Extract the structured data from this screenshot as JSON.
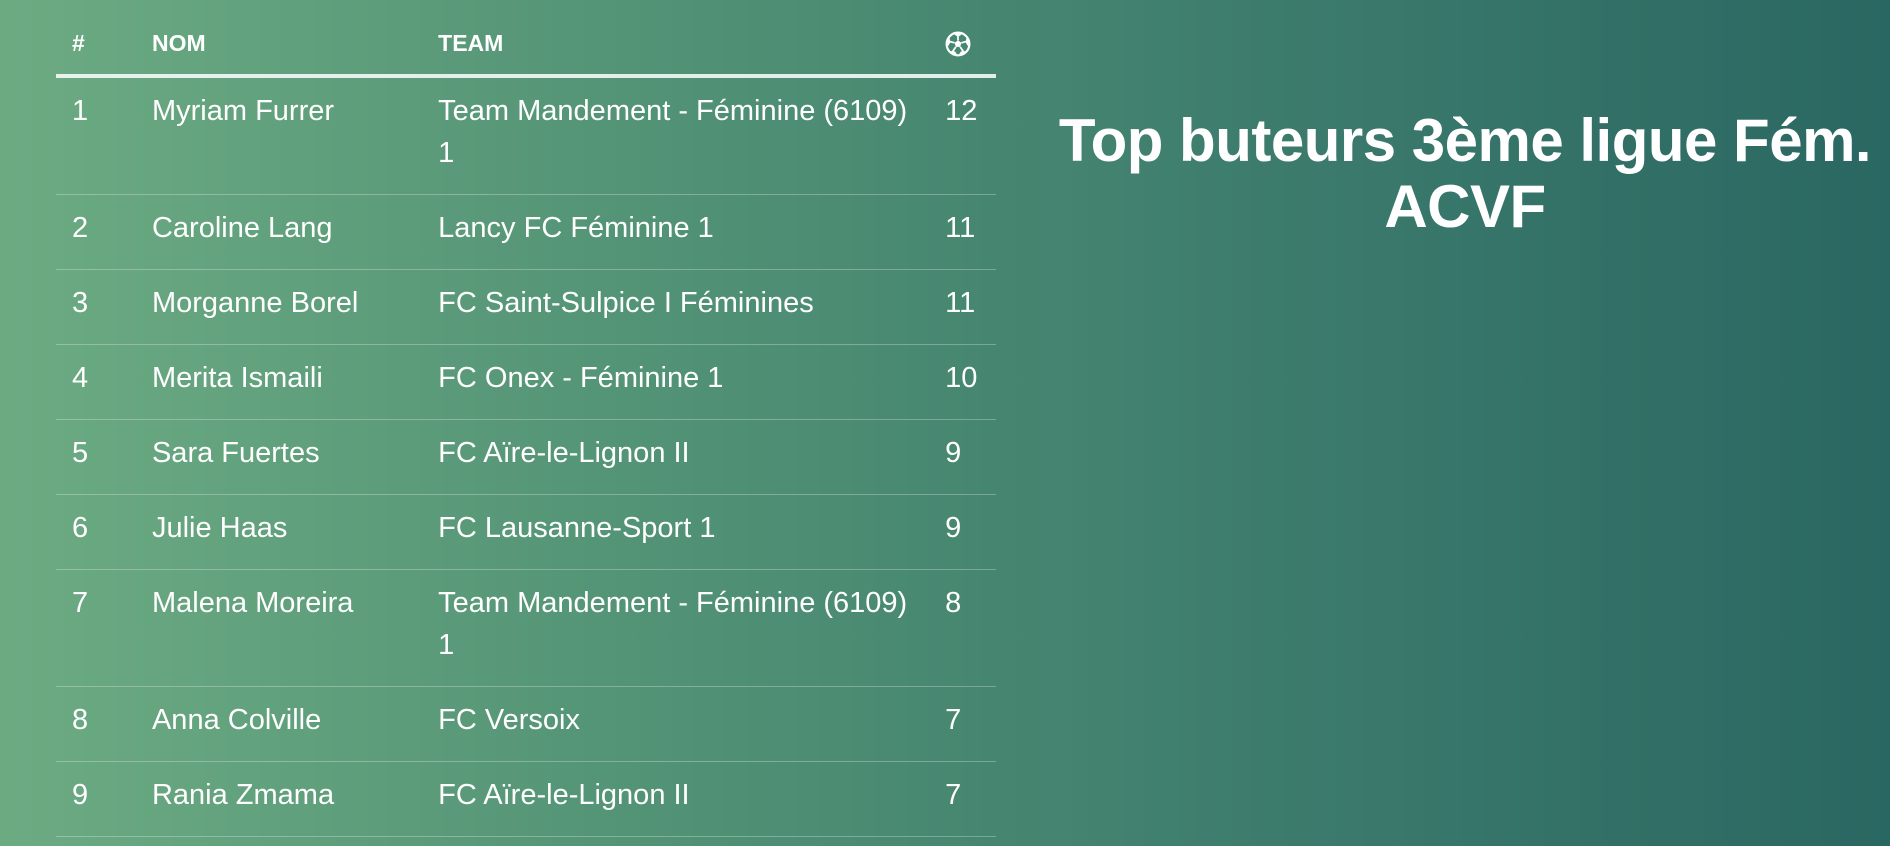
{
  "title": "Top buteurs 3ème ligue Fém. ACVF",
  "table": {
    "columns": {
      "rank": "#",
      "name": "NOM",
      "team": "TEAM",
      "goals_icon": "soccer-ball-icon"
    },
    "rows": [
      {
        "rank": "1",
        "name": "Myriam Furrer",
        "team": "Team Mandement - Féminine (6109) 1",
        "goals": "12"
      },
      {
        "rank": "2",
        "name": "Caroline Lang",
        "team": "Lancy FC Féminine 1",
        "goals": "11"
      },
      {
        "rank": "3",
        "name": "Morganne Borel",
        "team": "FC Saint-Sulpice I Féminines",
        "goals": "11"
      },
      {
        "rank": "4",
        "name": "Merita Ismaili",
        "team": "FC Onex - Féminine 1",
        "goals": "10"
      },
      {
        "rank": "5",
        "name": "Sara Fuertes",
        "team": "FC Aïre-le-Lignon II",
        "goals": "9"
      },
      {
        "rank": "6",
        "name": "Julie Haas",
        "team": "FC Lausanne-Sport 1",
        "goals": "9"
      },
      {
        "rank": "7",
        "name": "Malena Moreira",
        "team": "Team Mandement - Féminine (6109) 1",
        "goals": "8"
      },
      {
        "rank": "8",
        "name": "Anna Colville",
        "team": "FC Versoix",
        "goals": "7"
      },
      {
        "rank": "9",
        "name": "Rania Zmama",
        "team": "FC Aïre-le-Lignon II",
        "goals": "7"
      }
    ]
  },
  "colors": {
    "background_start": "#6cab82",
    "background_end": "#2a6762",
    "text": "#ffffff"
  }
}
